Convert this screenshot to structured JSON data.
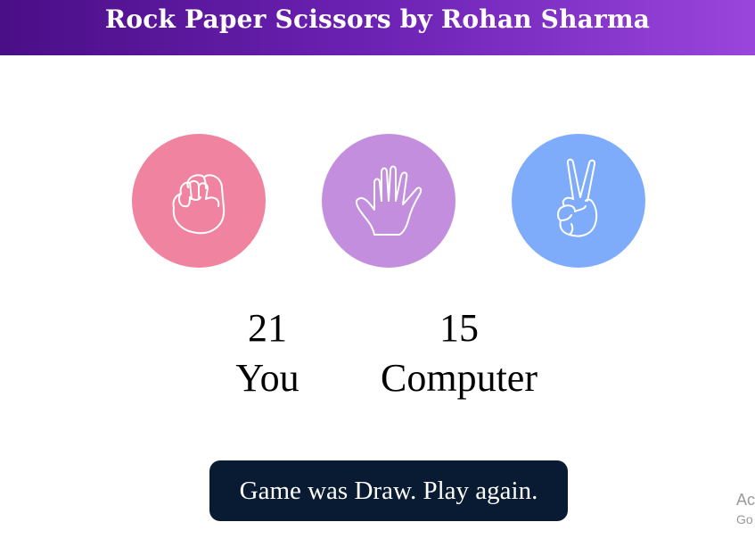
{
  "header": {
    "title": "Rock Paper Scissors by Rohan Sharma",
    "background_start": "#4a0e86",
    "background_end": "#9a45dc"
  },
  "choices": [
    {
      "name": "rock",
      "icon": "fist-icon",
      "color": "#f0839f"
    },
    {
      "name": "paper",
      "icon": "open-hand-icon",
      "color": "#c28edd"
    },
    {
      "name": "scissors",
      "icon": "victory-hand-icon",
      "color": "#7eacfa"
    }
  ],
  "scoreboard": {
    "user_score": "21",
    "user_label": "You",
    "computer_score": "15",
    "computer_label": "Computer"
  },
  "message": {
    "text": "Game was Draw. Play again.",
    "background": "#081b33"
  },
  "watermark": {
    "line1": "Ac",
    "line2": "Go"
  }
}
